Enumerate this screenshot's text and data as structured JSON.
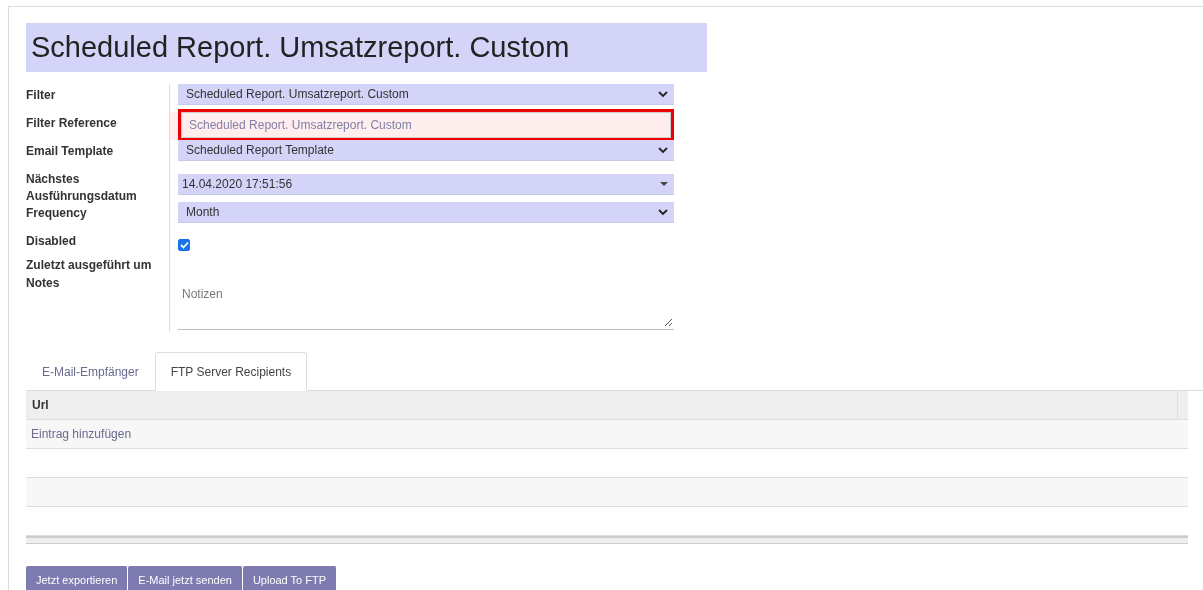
{
  "title": "Scheduled Report. Umsatzreport. Custom",
  "fields": [
    {
      "label": "Filter",
      "kind": "select",
      "value": "Scheduled Report. Umsatzreport. Custom",
      "highlighted": false
    },
    {
      "label": "Filter Reference",
      "kind": "text",
      "value": "Scheduled Report. Umsatzreport. Custom",
      "highlighted": true
    },
    {
      "label": "Email Template",
      "kind": "select",
      "value": "Scheduled Report Template",
      "highlighted": false
    },
    {
      "label": "Nächstes Ausführungsdatum",
      "kind": "datetime",
      "value": "14.04.2020 17:51:56",
      "highlighted": false
    },
    {
      "label": "Frequency",
      "kind": "select",
      "value": "Month",
      "highlighted": false
    },
    {
      "label": "Disabled",
      "kind": "checkbox",
      "checked": true,
      "highlighted": false
    },
    {
      "label": "Zuletzt ausgeführt um",
      "kind": "empty",
      "highlighted": false
    },
    {
      "label": "Notes",
      "kind": "textarea",
      "placeholder": "Notizen",
      "highlighted": false
    }
  ],
  "tabs": [
    {
      "label": "E-Mail-Empfänger",
      "selected": false
    },
    {
      "label": "FTP Server Recipients",
      "selected": true
    }
  ],
  "table": {
    "columns": [
      "Url"
    ],
    "add_link": "Eintrag hinzufügen"
  },
  "buttons": [
    "Jetzt exportieren",
    "E-Mail jetzt senden",
    "Upload To FTP"
  ]
}
